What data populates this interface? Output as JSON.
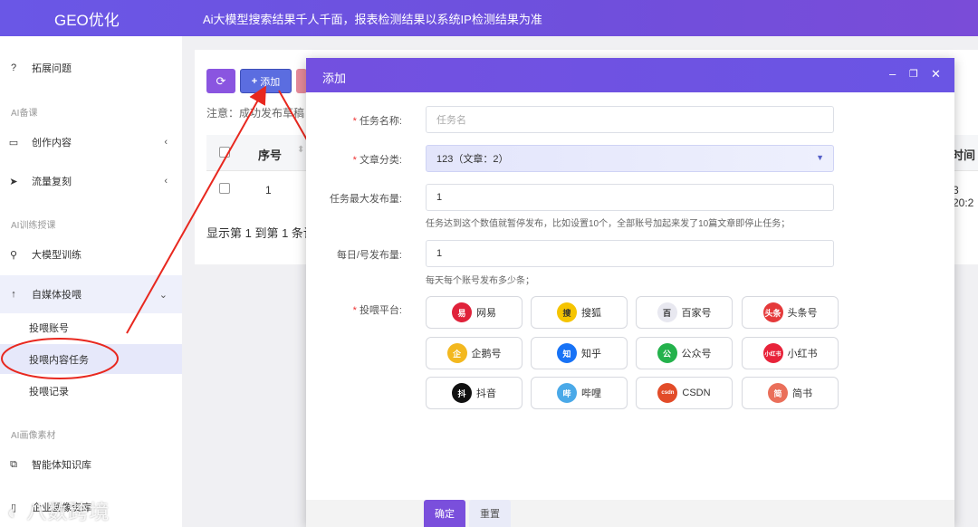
{
  "header": {
    "brand": "GEO优化",
    "notice": "Ai大模型搜索结果千人千面，报表检测结果以系统IP检测结果为准"
  },
  "sidebar": {
    "expand": "拓展问题",
    "group1": "AI备课",
    "create": "创作内容",
    "traffic": "流量复刻",
    "group2": "AI训练授课",
    "llm": "大模型训练",
    "media": "自媒体投喂",
    "sub_account": "投喂账号",
    "sub_task": "投喂内容任务",
    "sub_record": "投喂记录",
    "group3": "AI画像素材",
    "kb": "智能体知识库",
    "enterprise": "企业画像资库"
  },
  "main": {
    "add_label": "添加",
    "note": "注意：成功发布草稿",
    "col_seq": "序号",
    "col_time": "时间",
    "row_seq": "1",
    "row_time": "3 20:2",
    "footer": "显示第 1 到第 1 条记"
  },
  "modal": {
    "title": "添加",
    "task_name_label": "任务名称:",
    "task_name_placeholder": "任务名",
    "category_label": "文章分类:",
    "category_value": "123（文章：2）",
    "max_label": "任务最大发布量:",
    "max_value": "1",
    "max_hint": "任务达到这个数值就暂停发布，比如设置10个，全部账号加起来发了10篇文章即停止任务；",
    "daily_label": "每日/号发布量:",
    "daily_value": "1",
    "daily_hint": "每天每个账号发布多少条；",
    "platform_label": "投喂平台:",
    "confirm": "确定",
    "reset": "重置"
  },
  "platforms": [
    {
      "name": "网易",
      "icon": "易",
      "color": "#e0223a"
    },
    {
      "name": "搜狐",
      "icon": "搜",
      "color": "#f5c400"
    },
    {
      "name": "百家号",
      "icon": "百",
      "color": "#e8e8f0"
    },
    {
      "name": "头条号",
      "icon": "头条",
      "color": "#e5393a"
    },
    {
      "name": "企鹅号",
      "icon": "企",
      "color": "#f3b81f"
    },
    {
      "name": "知乎",
      "icon": "知",
      "color": "#1772f6"
    },
    {
      "name": "公众号",
      "icon": "公",
      "color": "#24b24c"
    },
    {
      "name": "小红书",
      "icon": "小红书",
      "color": "#e8233a"
    },
    {
      "name": "抖音",
      "icon": "抖",
      "color": "#111111"
    },
    {
      "name": "哔哩",
      "icon": "哔",
      "color": "#4aa9e8"
    },
    {
      "name": "CSDN",
      "icon": "csdn",
      "color": "#e24b28"
    },
    {
      "name": "简书",
      "icon": "简",
      "color": "#ea6f5a"
    }
  ],
  "watermark": "八数跨境"
}
